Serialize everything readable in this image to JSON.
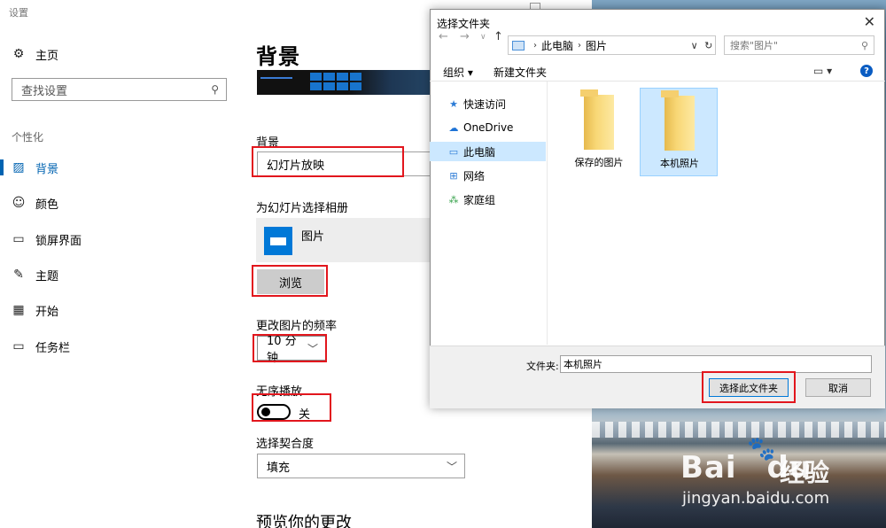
{
  "settings": {
    "window_title": "设置",
    "sidebar": {
      "home": {
        "icon": "gear-icon",
        "label": "主页"
      },
      "search_placeholder": "查找设置",
      "group_label": "个性化",
      "items": [
        {
          "icon": "picture-icon",
          "label": "背景",
          "active": true
        },
        {
          "icon": "palette-icon",
          "label": "颜色",
          "active": false
        },
        {
          "icon": "lockscreen-icon",
          "label": "锁屏界面",
          "active": false
        },
        {
          "icon": "themes-icon",
          "label": "主题",
          "active": false
        },
        {
          "icon": "start-icon",
          "label": "开始",
          "active": false
        },
        {
          "icon": "taskbar-icon",
          "label": "任务栏",
          "active": false
        }
      ]
    },
    "main": {
      "title": "背景",
      "background_label": "背景",
      "background_value": "幻灯片放映",
      "album_label": "为幻灯片选择相册",
      "album_name": "图片",
      "browse_button": "浏览",
      "frequency_label": "更改图片的频率",
      "frequency_value": "10 分钟",
      "shuffle_label": "无序播放",
      "shuffle_state": "关",
      "fit_label": "选择契合度",
      "fit_value": "填充",
      "preview_heading": "预览你的更改"
    }
  },
  "dialog": {
    "title": "选择文件夹",
    "breadcrumb": [
      "此电脑",
      "图片"
    ],
    "search_placeholder": "搜索\"图片\"",
    "toolbar": {
      "organize": "组织",
      "new_folder": "新建文件夹"
    },
    "nav_tree": [
      {
        "icon": "star-icon",
        "label": "快速访问",
        "selected": false
      },
      {
        "icon": "cloud-icon",
        "label": "OneDrive",
        "selected": false
      },
      {
        "icon": "computer-icon",
        "label": "此电脑",
        "selected": true
      },
      {
        "icon": "network-icon",
        "label": "网络",
        "selected": false
      },
      {
        "icon": "homegroup-icon",
        "label": "家庭组",
        "selected": false
      }
    ],
    "folders": [
      {
        "name": "保存的图片",
        "selected": false
      },
      {
        "name": "本机照片",
        "selected": true
      }
    ],
    "folder_field_label": "文件夹:",
    "folder_field_value": "本机照片",
    "select_button": "选择此文件夹",
    "cancel_button": "取消"
  },
  "watermark": {
    "brand": "Bai",
    "brand_suffix": "du",
    "brand_cn": "经验",
    "url": "jingyan.baidu.com"
  },
  "colors": {
    "accent": "#0063b1",
    "highlight_box": "#e2161d",
    "selection": "#cce8ff"
  }
}
